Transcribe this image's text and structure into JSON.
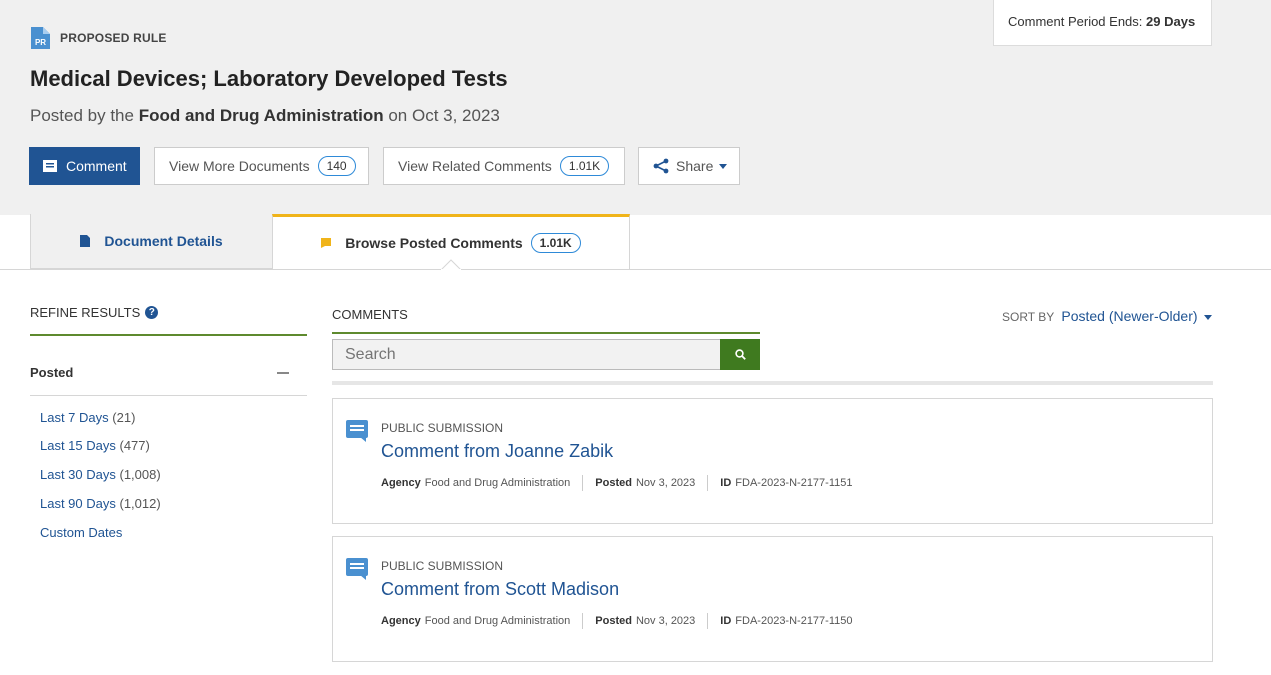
{
  "header": {
    "comment_period_label": "Comment Period Ends:",
    "comment_period_value": "29 Days",
    "doc_type_badge": "PR",
    "doc_type": "PROPOSED RULE",
    "title": "Medical Devices; Laboratory Developed Tests",
    "posted_prefix": "Posted by the",
    "agency": "Food and Drug Administration",
    "posted_suffix": "on Oct 3, 2023",
    "accent_color": "#205493"
  },
  "actions": {
    "comment_label": "Comment",
    "more_docs_label": "View More Documents",
    "more_docs_count": "140",
    "related_label": "View Related Comments",
    "related_count": "1.01K",
    "share_label": "Share"
  },
  "tabs": {
    "details_label": "Document Details",
    "browse_label": "Browse Posted Comments",
    "browse_count": "1.01K"
  },
  "sidebar": {
    "refine_label": "REFINE RESULTS",
    "help_icon_text": "?",
    "posted_heading": "Posted",
    "filters": [
      {
        "label": "Last 7 Days",
        "count": "(21)"
      },
      {
        "label": "Last 15 Days",
        "count": "(477)"
      },
      {
        "label": "Last 30 Days",
        "count": "(1,008)"
      },
      {
        "label": "Last 90 Days",
        "count": "(1,012)"
      },
      {
        "label": "Custom Dates",
        "count": ""
      }
    ]
  },
  "comments": {
    "section_label": "COMMENTS",
    "sort_label": "SORT BY",
    "sort_value": "Posted (Newer-Older)",
    "search_placeholder": "Search",
    "items": [
      {
        "type": "PUBLIC SUBMISSION",
        "title": "Comment from Joanne Zabik",
        "agency_label": "Agency",
        "agency": "Food and Drug Administration",
        "posted_label": "Posted",
        "posted": "Nov 3, 2023",
        "id_label": "ID",
        "id": "FDA-2023-N-2177-1151"
      },
      {
        "type": "PUBLIC SUBMISSION",
        "title": "Comment from Scott Madison",
        "agency_label": "Agency",
        "agency": "Food and Drug Administration",
        "posted_label": "Posted",
        "posted": "Nov 3, 2023",
        "id_label": "ID",
        "id": "FDA-2023-N-2177-1150"
      }
    ]
  },
  "icons": {
    "doc_type": "document-icon",
    "comment": "comment-icon",
    "share": "share-icon",
    "details_tab": "bookmark-icon",
    "browse_tab": "flag-icon",
    "help": "help-icon",
    "search": "search-icon",
    "comment_card": "speech-bubble-icon"
  }
}
